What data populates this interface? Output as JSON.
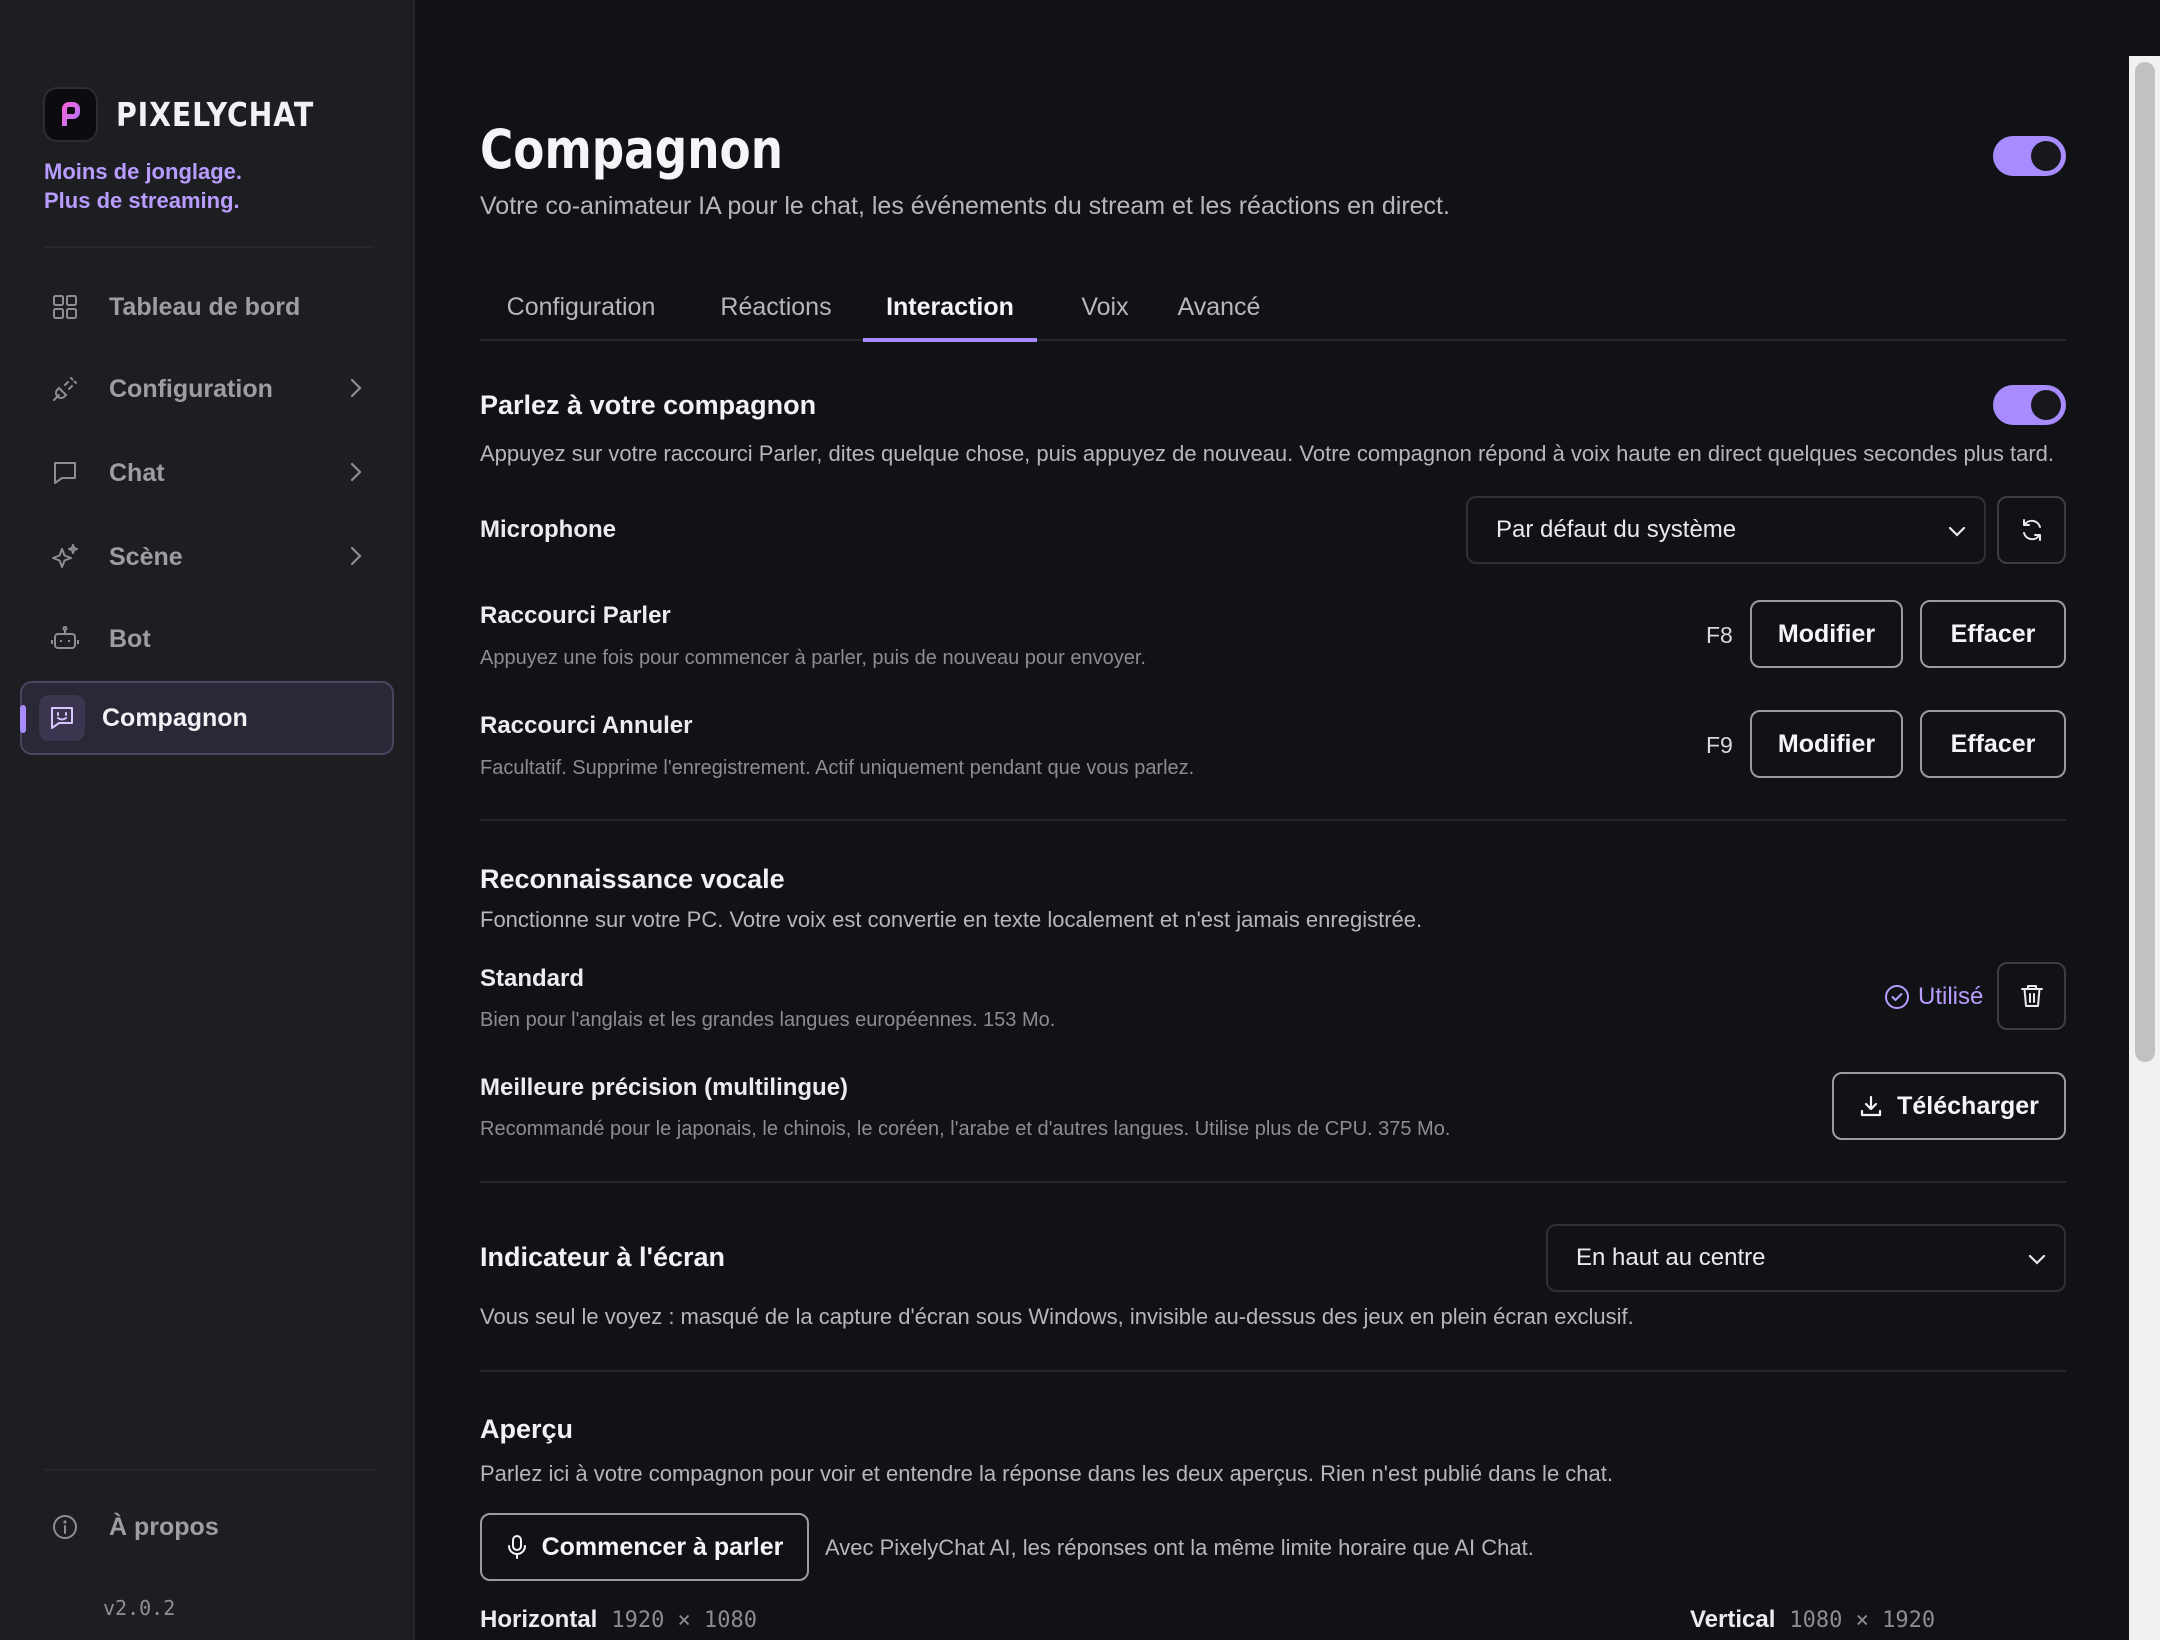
{
  "app": {
    "name": "PIXELYCHAT",
    "tagline_line1": "Moins de jonglage.",
    "tagline_line2": "Plus de streaming.",
    "version": "v2.0.2"
  },
  "colors": {
    "accent": "#a88bff",
    "background": "#111215",
    "sidebar": "#1d1e22"
  },
  "sidebar": {
    "items": [
      {
        "label": "Tableau de bord",
        "icon": "grid-icon"
      },
      {
        "label": "Configuration",
        "icon": "plug-icon"
      },
      {
        "label": "Chat",
        "icon": "chat-bubble-icon"
      },
      {
        "label": "Scène",
        "icon": "sparkles-icon"
      },
      {
        "label": "Bot",
        "icon": "robot-icon"
      },
      {
        "label": "Compagnon",
        "icon": "companion-icon",
        "active": true
      }
    ],
    "about": "À propos"
  },
  "page": {
    "title": "Compagnon",
    "subtitle": "Votre co-animateur IA pour le chat, les événements du stream et les réactions en direct.",
    "enabled": true
  },
  "tabs": [
    {
      "label": "Configuration"
    },
    {
      "label": "Réactions"
    },
    {
      "label": "Interaction",
      "active": true
    },
    {
      "label": "Voix"
    },
    {
      "label": "Avancé"
    }
  ],
  "talk": {
    "title": "Parlez à votre compagnon",
    "desc": "Appuyez sur votre raccourci Parler, dites quelque chose, puis appuyez de nouveau. Votre compagnon répond à voix haute en direct quelques secondes plus tard.",
    "enabled": true,
    "mic_label": "Microphone",
    "mic_value": "Par défaut du système",
    "talk_shortcut": {
      "title": "Raccourci Parler",
      "desc": "Appuyez une fois pour commencer à parler, puis de nouveau pour envoyer.",
      "key": "F8"
    },
    "cancel_shortcut": {
      "title": "Raccourci Annuler",
      "desc": "Facultatif. Supprime l'enregistrement. Actif uniquement pendant que vous parlez.",
      "key": "F9"
    },
    "modify_label": "Modifier",
    "clear_label": "Effacer"
  },
  "speech": {
    "title": "Reconnaissance vocale",
    "desc": "Fonctionne sur votre PC. Votre voix est convertie en texte localement et n'est jamais enregistrée.",
    "standard": {
      "title": "Standard",
      "desc": "Bien pour l'anglais et les grandes langues européennes. 153 Mo.",
      "status": "Utilisé"
    },
    "better": {
      "title": "Meilleure précision (multilingue)",
      "desc": "Recommandé pour le japonais, le chinois, le coréen, l'arabe et d'autres langues. Utilise plus de CPU. 375 Mo.",
      "button": "Télécharger"
    }
  },
  "indicator": {
    "title": "Indicateur à l'écran",
    "value": "En haut au centre",
    "desc": "Vous seul le voyez : masqué de la capture d'écran sous Windows, invisible au-dessus des jeux en plein écran exclusif."
  },
  "preview": {
    "title": "Aperçu",
    "desc": "Parlez ici à votre compagnon pour voir et entendre la réponse dans les deux aperçus. Rien n'est publié dans le chat.",
    "button": "Commencer à parler",
    "note": "Avec PixelyChat AI, les réponses ont la même limite horaire que AI Chat.",
    "horizontal_label": "Horizontal",
    "horizontal_size": "1920 × 1080",
    "vertical_label": "Vertical",
    "vertical_size": "1080 × 1920"
  }
}
